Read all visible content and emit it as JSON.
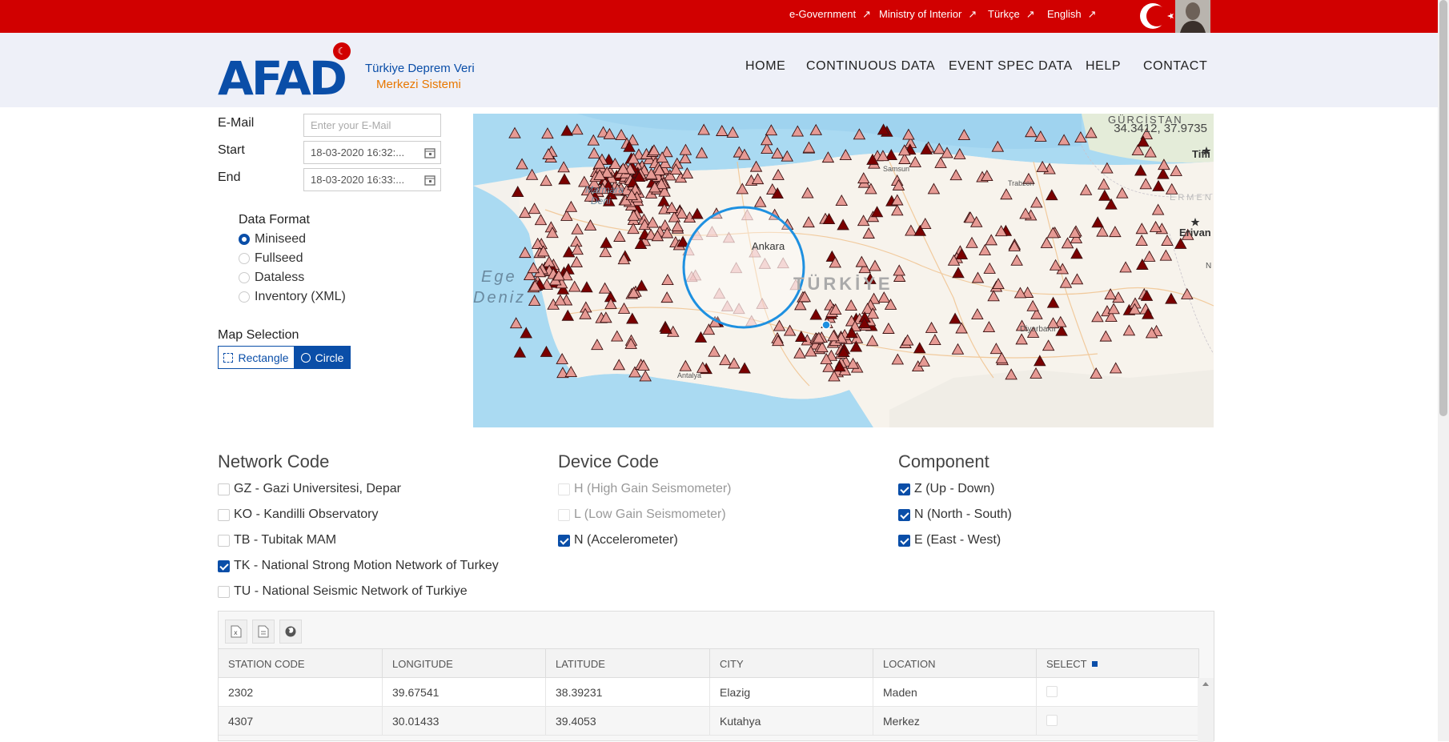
{
  "topbar": {
    "links": [
      "e-Government",
      "Ministry of Interior",
      "Türkçe",
      "English"
    ]
  },
  "header": {
    "logo": "AFAD",
    "tagline1": "Türkiye Deprem Veri",
    "tagline2": "Merkezi Sistemi",
    "nav": [
      "HOME",
      "CONTINUOUS DATA",
      "EVENT SPEC DATA",
      "HELP",
      "CONTACT"
    ]
  },
  "form": {
    "email_label": "E-Mail",
    "email_placeholder": "Enter your E-Mail",
    "start_label": "Start",
    "start_value": "18-03-2020 16:32:...",
    "end_label": "End",
    "end_value": "18-03-2020 16:33:...",
    "format_title": "Data Format",
    "formats": [
      "Miniseed",
      "Fullseed",
      "Dataless",
      "Inventory (XML)"
    ],
    "selected_format": "Miniseed",
    "map_selection_title": "Map Selection",
    "rect_label": "Rectangle",
    "circle_label": "Circle"
  },
  "map": {
    "coords": "34.3412, 37.9735",
    "labels": [
      "GÜRCİSTAN",
      "Tifli",
      "ERMENİ",
      "Erivan",
      "TÜRKİYE",
      "Ankara",
      "Samsun",
      "Trabzon",
      "Diyarbakır",
      "Ege",
      "Deniz",
      "Marmara",
      "Deni",
      "Antalya",
      "N"
    ]
  },
  "network": {
    "title": "Network Code",
    "items": [
      {
        "label": "GZ - Gazi Universitesi, Depar",
        "checked": false
      },
      {
        "label": "KO - Kandilli Observatory",
        "checked": false
      },
      {
        "label": "TB - Tubitak MAM",
        "checked": false
      },
      {
        "label": "TK - National Strong Motion Network of Turkey",
        "checked": true
      },
      {
        "label": "TU - National Seismic Network of Turkiye",
        "checked": false
      }
    ]
  },
  "device": {
    "title": "Device Code",
    "items": [
      {
        "label": "H (High Gain Seismometer)",
        "checked": false,
        "disabled": true
      },
      {
        "label": "L (Low Gain Seismometer)",
        "checked": false,
        "disabled": true
      },
      {
        "label": "N (Accelerometer)",
        "checked": true,
        "disabled": false
      }
    ]
  },
  "component": {
    "title": "Component",
    "items": [
      {
        "label": "Z (Up - Down)",
        "checked": true
      },
      {
        "label": "N (North - South)",
        "checked": true
      },
      {
        "label": "E (East - West)",
        "checked": true
      }
    ]
  },
  "grid": {
    "toolbar_icons": [
      "excel-export-icon",
      "pdf-export-icon",
      "globe-icon"
    ],
    "columns": [
      "STATION CODE",
      "LONGITUDE",
      "LATITUDE",
      "CITY",
      "LOCATION",
      "SELECT"
    ],
    "rows": [
      [
        "2302",
        "39.67541",
        "38.39231",
        "Elazig",
        "Maden"
      ],
      [
        "4307",
        "30.01433",
        "39.4053",
        "Kutahya",
        "Merkez"
      ]
    ]
  },
  "colors": {
    "brand_red": "#d10000",
    "brand_blue": "#0a4ea8",
    "accent_orange": "#e87700"
  }
}
